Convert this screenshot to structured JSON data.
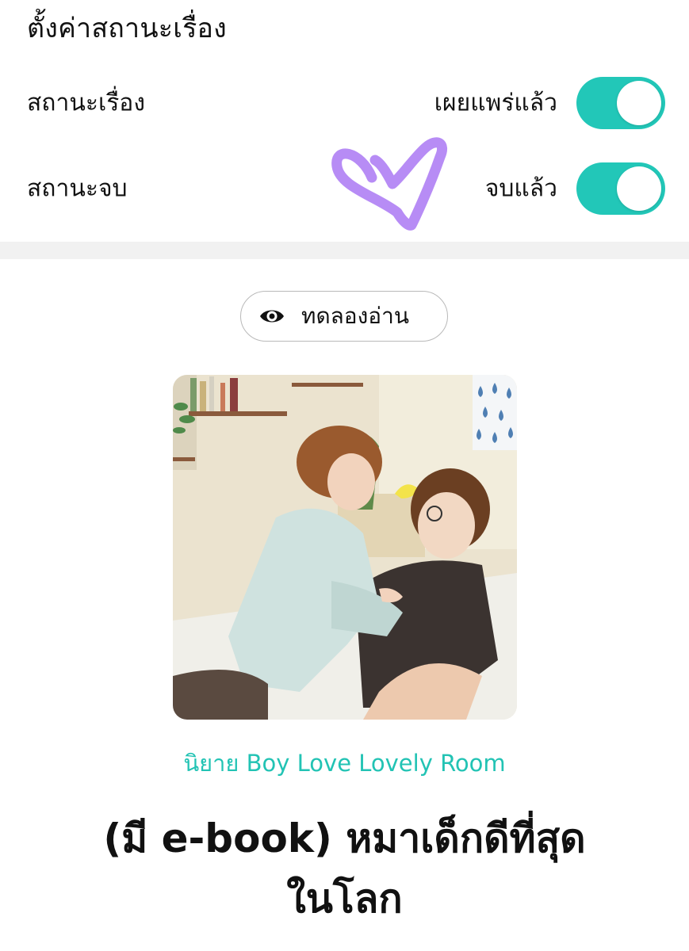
{
  "settings": {
    "title": "ตั้งค่าสถานะเรื่อง",
    "rows": [
      {
        "label": "สถานะเรื่อง",
        "value": "เผยแพร่แล้ว",
        "on": true
      },
      {
        "label": "สถานะจบ",
        "value": "จบแล้ว",
        "on": true
      }
    ],
    "toggle_color": "#22c7b8"
  },
  "heart_color": "#b78cf5",
  "preview_button": {
    "label": "ทดลองอ่าน",
    "icon": "eye-icon"
  },
  "book": {
    "category": "นิยาย Boy Love Lovely Room",
    "title_line1": "(มี e-book) หมาเด็กดีที่สุด",
    "title_line2": "ในโลก",
    "accent": "#22c3b4"
  }
}
